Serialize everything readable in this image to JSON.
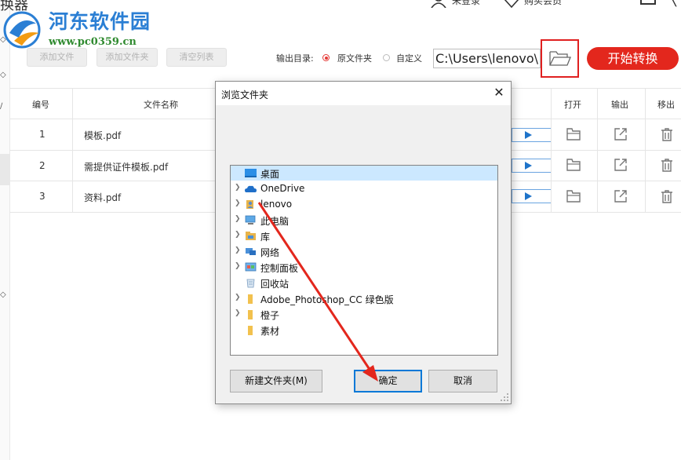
{
  "app": {
    "title_fragment": "换器",
    "watermark": {
      "name": "河东软件园",
      "url": "www.pc0359.cn"
    },
    "header": {
      "login_label": "未登录",
      "vip_label": "购买会员"
    }
  },
  "toolbar": {
    "add_file": "添加文件",
    "add_folder": "添加文件夹",
    "clear_list": "清空列表",
    "output_dir_label": "输出目录:",
    "radio_original": "原文件夹",
    "radio_custom": "自定义",
    "output_path": "C:\\Users\\lenovo\\",
    "start_label": "开始转换",
    "accent_color": "#e3271d"
  },
  "table": {
    "headers": {
      "index": "编号",
      "name": "文件名称",
      "open": "打开",
      "output": "输出",
      "remove": "移出"
    },
    "rows": [
      {
        "index": "1",
        "name": "模板.pdf"
      },
      {
        "index": "2",
        "name": "需提供证件模板.pdf"
      },
      {
        "index": "3",
        "name": "资料.pdf"
      }
    ]
  },
  "dialog": {
    "title": "浏览文件夹",
    "tree": [
      {
        "label": "桌面",
        "icon": "desktop-icon",
        "selected": true,
        "expandable": false
      },
      {
        "label": "OneDrive",
        "icon": "cloud-icon",
        "expandable": true
      },
      {
        "label": "lenovo",
        "icon": "user-folder-icon",
        "expandable": true
      },
      {
        "label": "此电脑",
        "icon": "computer-icon",
        "expandable": true
      },
      {
        "label": "库",
        "icon": "library-icon",
        "expandable": true
      },
      {
        "label": "网络",
        "icon": "network-icon",
        "expandable": true
      },
      {
        "label": "控制面板",
        "icon": "control-panel-icon",
        "expandable": true
      },
      {
        "label": "回收站",
        "icon": "recycle-bin-icon",
        "expandable": false
      },
      {
        "label": "Adobe_Photoshop_CC 绿色版",
        "icon": "folder-icon",
        "expandable": true
      },
      {
        "label": "橙子",
        "icon": "folder-icon",
        "expandable": true
      },
      {
        "label": "素材",
        "icon": "folder-icon",
        "expandable": false
      }
    ],
    "new_folder_label": "新建文件夹(M)",
    "ok_label": "确定",
    "cancel_label": "取消"
  }
}
